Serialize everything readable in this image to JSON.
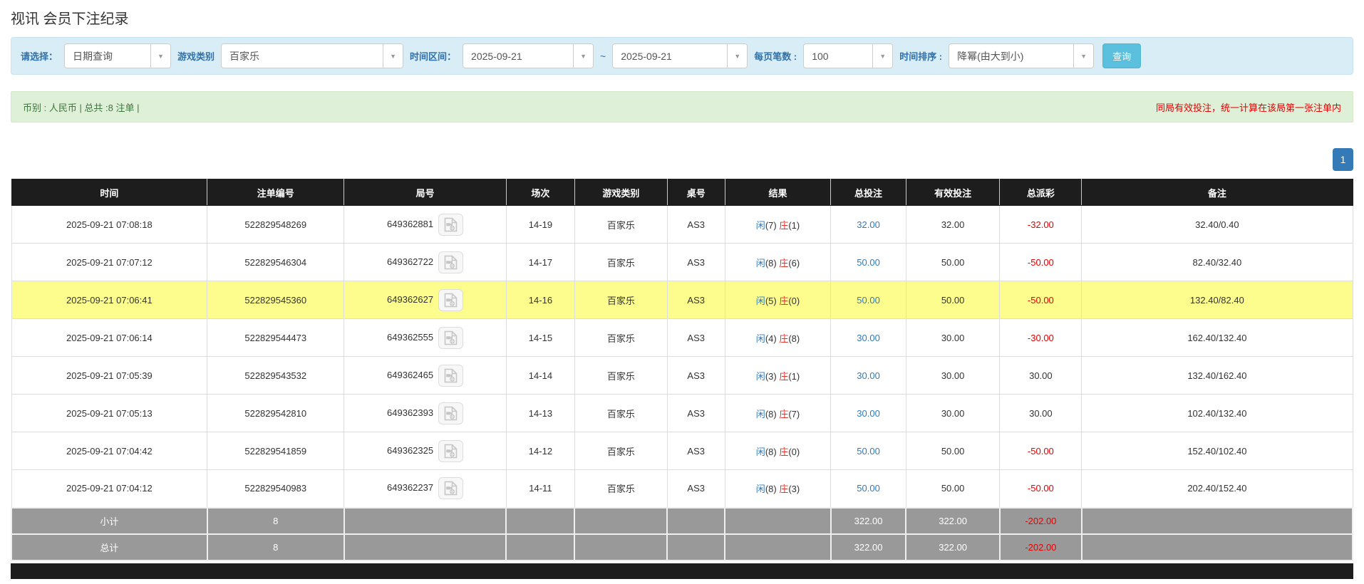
{
  "page_title": "视讯 会员下注纪录",
  "filters": {
    "select_label": "请选择：",
    "select_value": "日期查询",
    "game_type_label": "游戏类别",
    "game_type_value": "百家乐",
    "date_range_label": "时间区间：",
    "date_from": "2025-09-21",
    "date_separator": "~",
    "date_to": "2025-09-21",
    "page_size_label": "每页笔数 :",
    "page_size_value": "100",
    "sort_label": "时间排序 :",
    "sort_value": "降幂(由大到小)",
    "search_button": "查询"
  },
  "summary_bar": {
    "left_text": "币别 : 人民币 | 总共 :8 注单 |",
    "right_notice": "同局有效投注，统一计算在该局第一张注单内"
  },
  "pagination": {
    "current_page": "1"
  },
  "table": {
    "headers": [
      "时间",
      "注单编号",
      "局号",
      "场次",
      "游戏类别",
      "桌号",
      "结果",
      "总投注",
      "有效投注",
      "总派彩",
      "备注"
    ],
    "result_player_label": "闲",
    "result_banker_label": "庄",
    "rows": [
      {
        "time": "2025-09-21 07:08:18",
        "bet_id": "522829548269",
        "round_id": "649362881",
        "session": "14-19",
        "game": "百家乐",
        "table_id": "AS3",
        "player": "7",
        "banker": "1",
        "total_bet": "32.00",
        "valid_bet": "32.00",
        "payout": "-32.00",
        "remark": "32.40/0.40",
        "highlight": false
      },
      {
        "time": "2025-09-21 07:07:12",
        "bet_id": "522829546304",
        "round_id": "649362722",
        "session": "14-17",
        "game": "百家乐",
        "table_id": "AS3",
        "player": "8",
        "banker": "6",
        "total_bet": "50.00",
        "valid_bet": "50.00",
        "payout": "-50.00",
        "remark": "82.40/32.40",
        "highlight": false
      },
      {
        "time": "2025-09-21 07:06:41",
        "bet_id": "522829545360",
        "round_id": "649362627",
        "session": "14-16",
        "game": "百家乐",
        "table_id": "AS3",
        "player": "5",
        "banker": "0",
        "total_bet": "50.00",
        "valid_bet": "50.00",
        "payout": "-50.00",
        "remark": "132.40/82.40",
        "highlight": true
      },
      {
        "time": "2025-09-21 07:06:14",
        "bet_id": "522829544473",
        "round_id": "649362555",
        "session": "14-15",
        "game": "百家乐",
        "table_id": "AS3",
        "player": "4",
        "banker": "8",
        "total_bet": "30.00",
        "valid_bet": "30.00",
        "payout": "-30.00",
        "remark": "162.40/132.40",
        "highlight": false
      },
      {
        "time": "2025-09-21 07:05:39",
        "bet_id": "522829543532",
        "round_id": "649362465",
        "session": "14-14",
        "game": "百家乐",
        "table_id": "AS3",
        "player": "3",
        "banker": "1",
        "total_bet": "30.00",
        "valid_bet": "30.00",
        "payout": "30.00",
        "remark": "132.40/162.40",
        "highlight": false
      },
      {
        "time": "2025-09-21 07:05:13",
        "bet_id": "522829542810",
        "round_id": "649362393",
        "session": "14-13",
        "game": "百家乐",
        "table_id": "AS3",
        "player": "8",
        "banker": "7",
        "total_bet": "30.00",
        "valid_bet": "30.00",
        "payout": "30.00",
        "remark": "102.40/132.40",
        "highlight": false
      },
      {
        "time": "2025-09-21 07:04:42",
        "bet_id": "522829541859",
        "round_id": "649362325",
        "session": "14-12",
        "game": "百家乐",
        "table_id": "AS3",
        "player": "8",
        "banker": "0",
        "total_bet": "50.00",
        "valid_bet": "50.00",
        "payout": "-50.00",
        "remark": "152.40/102.40",
        "highlight": false
      },
      {
        "time": "2025-09-21 07:04:12",
        "bet_id": "522829540983",
        "round_id": "649362237",
        "session": "14-11",
        "game": "百家乐",
        "table_id": "AS3",
        "player": "8",
        "banker": "3",
        "total_bet": "50.00",
        "valid_bet": "50.00",
        "payout": "-50.00",
        "remark": "202.40/152.40",
        "highlight": false
      }
    ],
    "subtotal": {
      "label": "小计",
      "count": "8",
      "total_bet": "322.00",
      "valid_bet": "322.00",
      "payout": "-202.00",
      "remark": ""
    },
    "total": {
      "label": "总计",
      "count": "8",
      "total_bet": "322.00",
      "valid_bet": "322.00",
      "payout": "-202.00",
      "remark": ""
    }
  },
  "colors": {
    "accent_blue": "#337ab7",
    "negative_red": "#e60000",
    "banker_red": "#d9342c",
    "highlight_yellow": "#fdfd8e",
    "header_black": "#1d1d1d",
    "summary_gray": "#999999"
  }
}
